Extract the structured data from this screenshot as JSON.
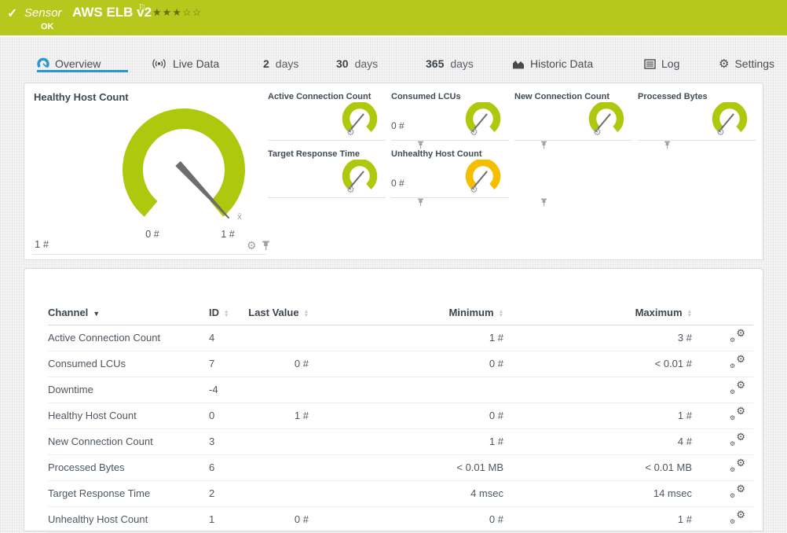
{
  "header": {
    "sensor_type_label": "Sensor",
    "sensor_name": "AWS ELB v2",
    "priority_stars_filled": "★★★",
    "priority_stars_empty": "☆☆",
    "status": "OK",
    "bg_color": "#b6c81c"
  },
  "accent_blue": "#2a96d2",
  "tabs": [
    {
      "label": "Overview",
      "icon": "gauge-icon",
      "active": true
    },
    {
      "label": "Live Data",
      "icon": "live-data-icon"
    },
    {
      "num": "2",
      "unit": "days"
    },
    {
      "num": "30",
      "unit": "days"
    },
    {
      "num": "365",
      "unit": "days"
    },
    {
      "label": "Historic Data",
      "icon": "historic-chart-icon"
    },
    {
      "label": "Log",
      "icon": "log-icon"
    },
    {
      "label": "Settings",
      "icon": "gear-icon"
    }
  ],
  "gauges": {
    "main": {
      "title": "Healthy Host Count",
      "value": "1 #",
      "scale_min": "0 #",
      "scale_max": "1 #",
      "avg_marker": "x̄",
      "color": "#aec80e"
    },
    "minis": [
      {
        "title": "Active Connection Count",
        "value": "",
        "color": "#aec80e"
      },
      {
        "title": "Consumed LCUs",
        "value": "0 #",
        "color": "#aec80e"
      },
      {
        "title": "New Connection Count",
        "value": "",
        "color": "#aec80e"
      },
      {
        "title": "Processed Bytes",
        "value": "",
        "color": "#aec80e"
      },
      {
        "title": "Target Response Time",
        "value": "",
        "color": "#aec80e"
      },
      {
        "title": "Unhealthy Host Count",
        "value": "0 #",
        "color": "#f6be00"
      }
    ]
  },
  "table": {
    "columns": {
      "channel": "Channel",
      "id": "ID",
      "last_value": "Last Value",
      "minimum": "Minimum",
      "maximum": "Maximum"
    },
    "sorted_by": "Channel",
    "rows": [
      {
        "name": "Active Connection Count",
        "id": "4",
        "last": "",
        "min": "1 #",
        "max": "3 #"
      },
      {
        "name": "Consumed LCUs",
        "id": "7",
        "last": "0 #",
        "min": "0 #",
        "max": "< 0.01 #"
      },
      {
        "name": "Downtime",
        "id": "-4",
        "last": "",
        "min": "",
        "max": ""
      },
      {
        "name": "Healthy Host Count",
        "id": "0",
        "last": "1 #",
        "min": "0 #",
        "max": "1 #"
      },
      {
        "name": "New Connection Count",
        "id": "3",
        "last": "",
        "min": "1 #",
        "max": "4 #"
      },
      {
        "name": "Processed Bytes",
        "id": "6",
        "last": "",
        "min": "< 0.01 MB",
        "max": "< 0.01 MB"
      },
      {
        "name": "Target Response Time",
        "id": "2",
        "last": "",
        "min": "4 msec",
        "max": "14 msec"
      },
      {
        "name": "Unhealthy Host Count",
        "id": "1",
        "last": "0 #",
        "min": "0 #",
        "max": "1 #"
      }
    ]
  }
}
